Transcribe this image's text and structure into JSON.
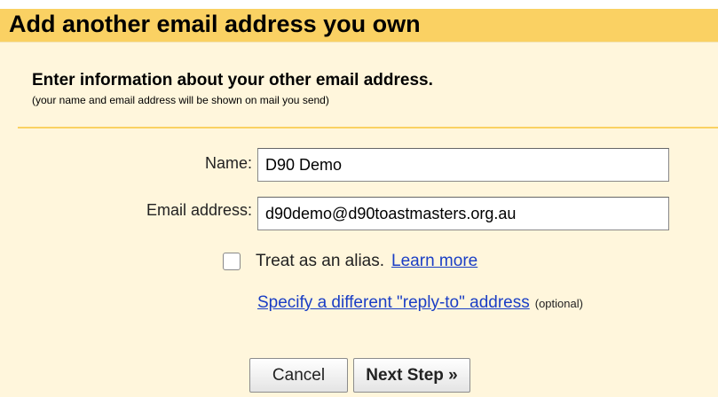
{
  "dialog": {
    "title": "Add another email address you own",
    "heading": "Enter information about your other email address.",
    "subheading": "(your name and email address will be shown on mail you send)"
  },
  "form": {
    "name_label": "Name:",
    "name_value": "D90 Demo",
    "email_label": "Email address:",
    "email_value": "d90demo@d90toastmasters.org.au",
    "alias_checked": false,
    "alias_label": "Treat as an alias.",
    "learn_more_link": "Learn more",
    "reply_to_link": "Specify a different \"reply-to\" address",
    "optional_note": "(optional)"
  },
  "buttons": {
    "cancel": "Cancel",
    "next_step": "Next Step »"
  },
  "colors": {
    "title_bar": "#fad163",
    "background": "#fff6dc",
    "link": "#1a3ec5"
  },
  "icons": {
    "alias_checkbox": "checkbox-unchecked"
  }
}
